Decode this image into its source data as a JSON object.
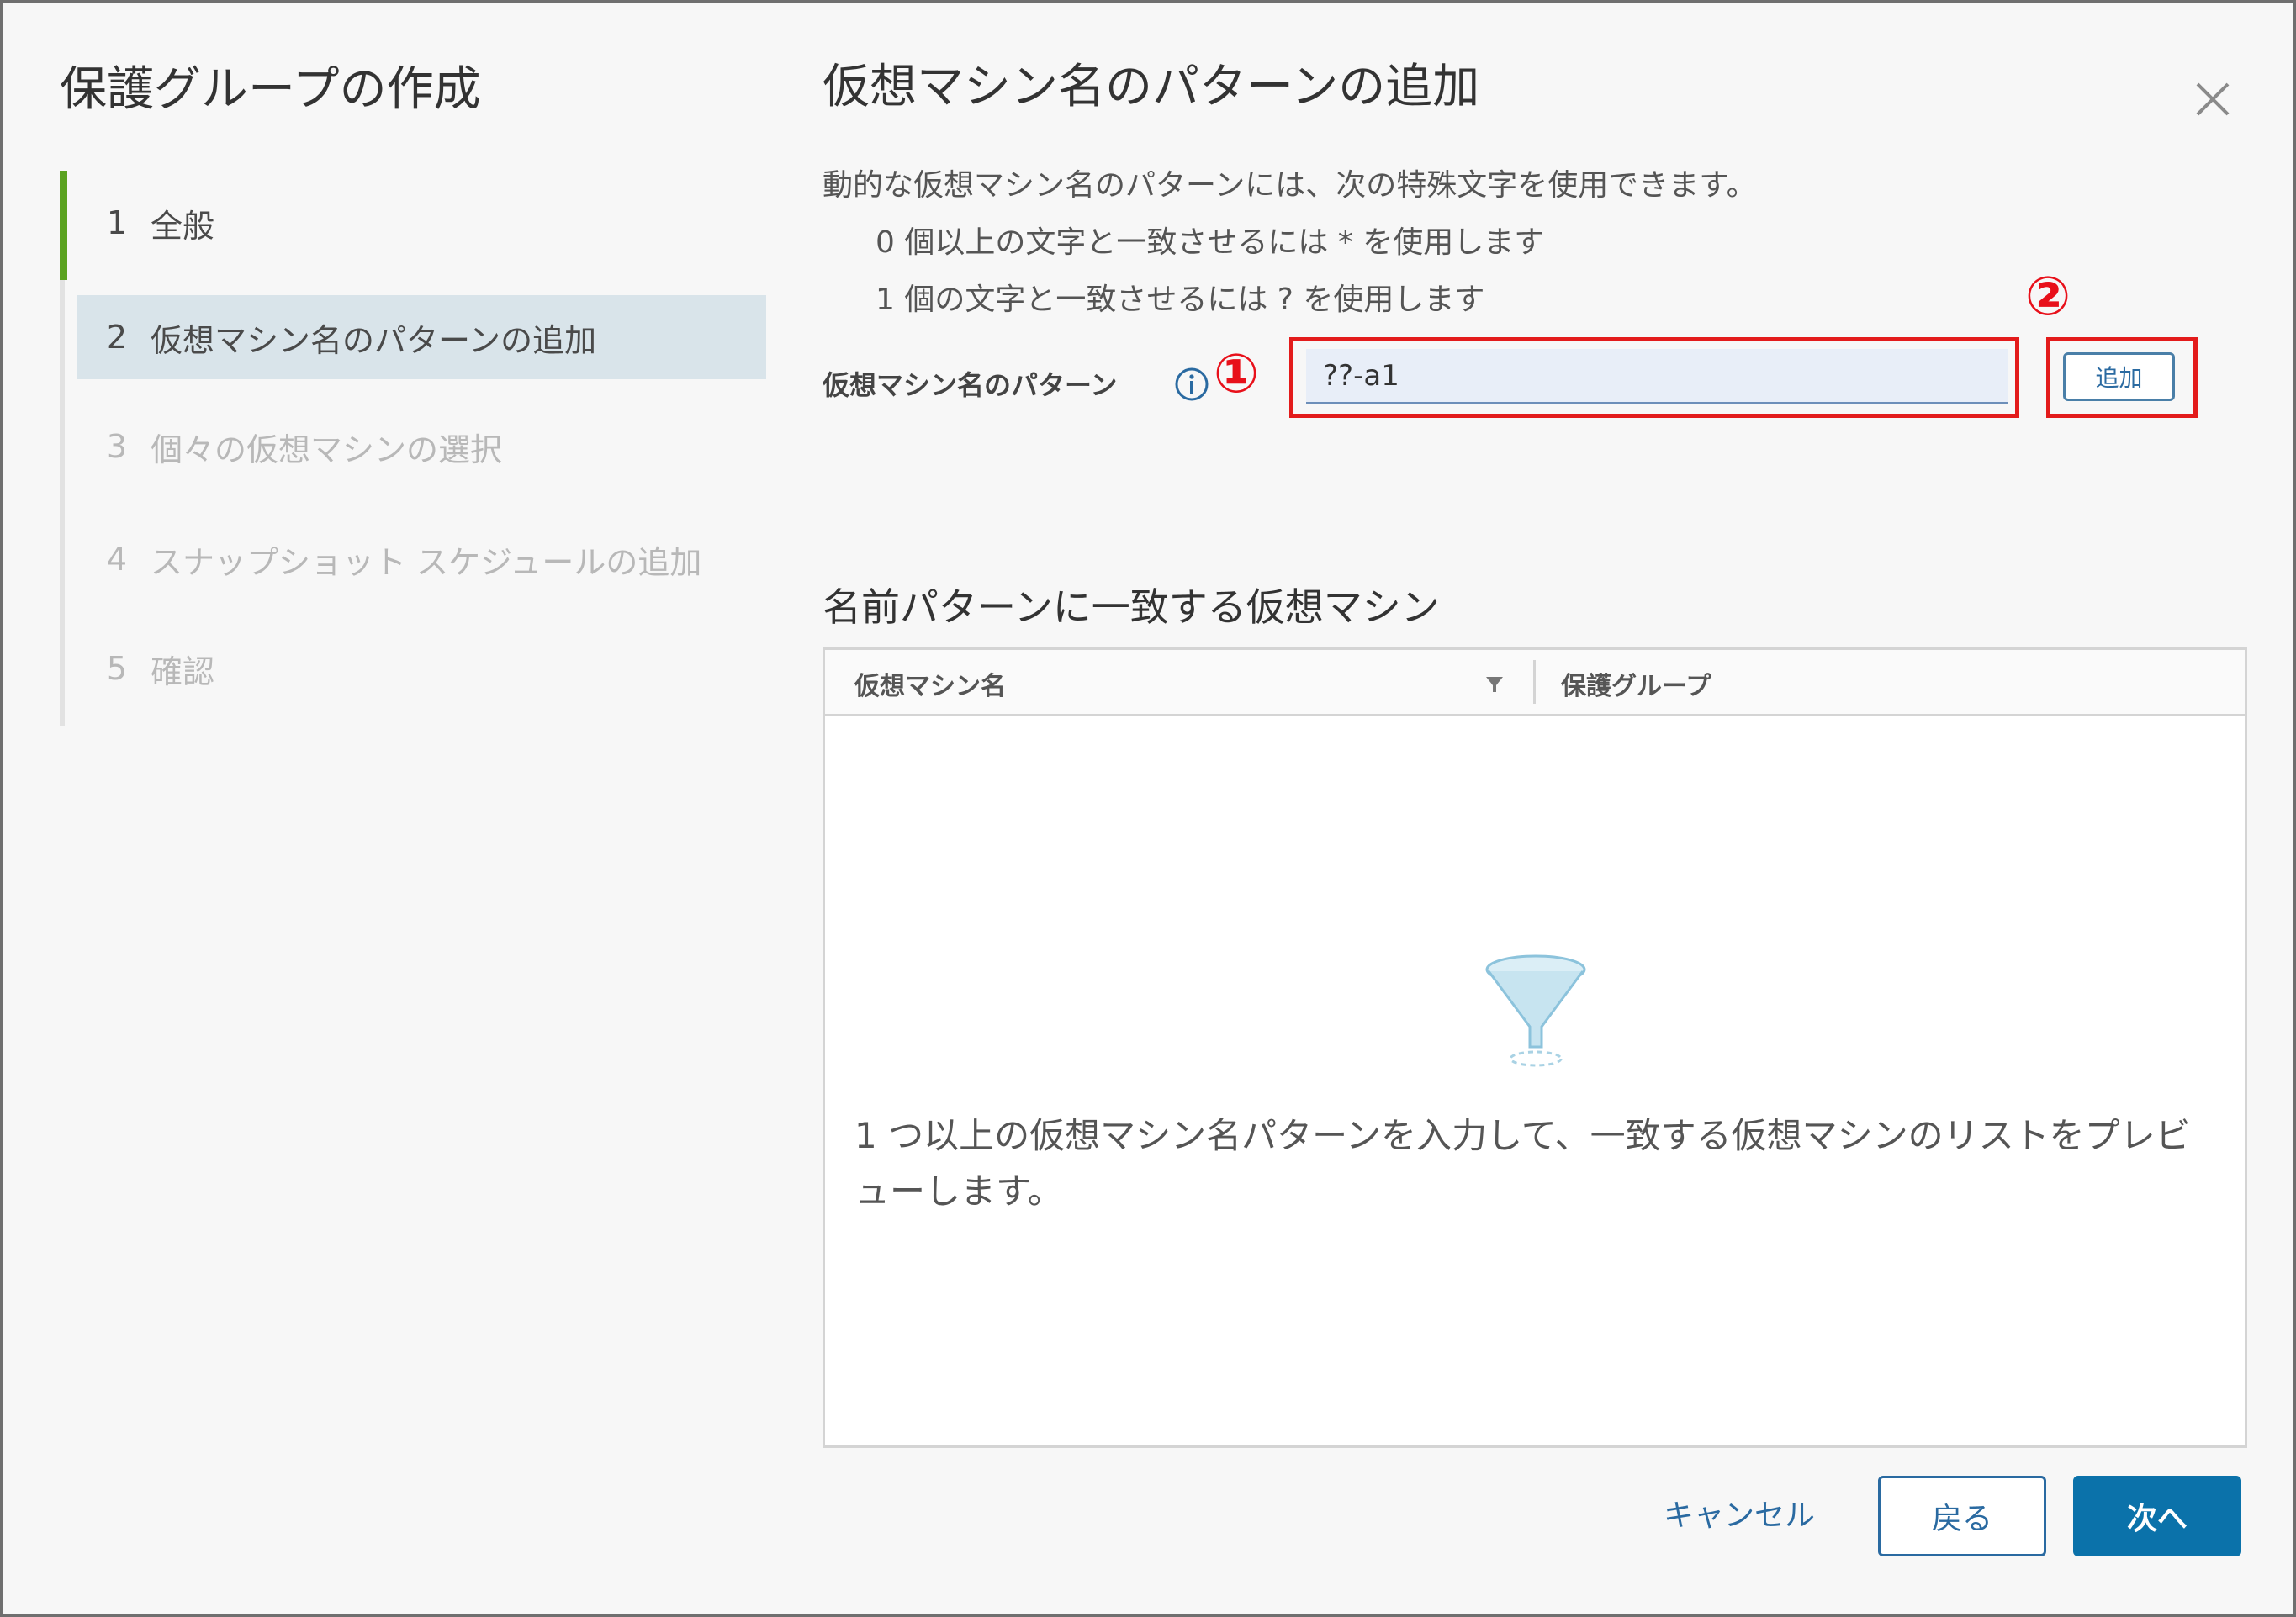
{
  "wizard": {
    "title": "保護グループの作成",
    "steps": [
      {
        "num": "1",
        "label": "全般"
      },
      {
        "num": "2",
        "label": "仮想マシン名のパターンの追加"
      },
      {
        "num": "3",
        "label": "個々の仮想マシンの選択"
      },
      {
        "num": "4",
        "label": "スナップショット スケジュールの追加"
      },
      {
        "num": "5",
        "label": "確認"
      }
    ]
  },
  "main": {
    "title": "仮想マシン名のパターンの追加",
    "description": "動的な仮想マシン名のパターンには、次の特殊文字を使用できます。",
    "rule_asterisk": "0 個以上の文字と一致させるには * を使用します",
    "rule_question": "1 個の文字と一致させるには ? を使用します",
    "pattern_label": "仮想マシン名のパターン",
    "pattern_value": "??-a1",
    "add_label": "追加",
    "badge_1": "①",
    "badge_2": "②"
  },
  "matching": {
    "title": "名前パターンに一致する仮想マシン",
    "columns": [
      "仮想マシン名",
      "保護グループ"
    ],
    "empty_message": "1 つ以上の仮想マシン名パターンを入力して、一致する仮想マシンのリストをプレビューします。"
  },
  "footer": {
    "cancel": "キャンセル",
    "back": "戻る",
    "next": "次へ"
  },
  "colors": {
    "accent_blue": "#0b72aa",
    "highlight_red": "#e31b1b",
    "active_step_green": "#5aa220"
  },
  "icons": [
    "close-icon",
    "info-icon",
    "filter-icon",
    "empty-funnel-icon"
  ]
}
